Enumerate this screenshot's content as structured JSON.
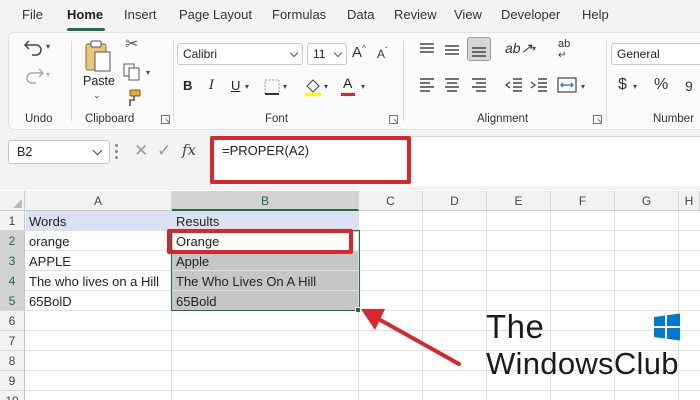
{
  "menu": {
    "items": [
      "File",
      "Home",
      "Insert",
      "Page Layout",
      "Formulas",
      "Data",
      "Review",
      "View",
      "Developer",
      "Help"
    ],
    "active": "Home"
  },
  "ribbon": {
    "groups": {
      "undo": "Undo",
      "clipboard": "Clipboard",
      "font": "Font",
      "alignment": "Alignment",
      "number": "Number"
    },
    "paste_label": "Paste",
    "font_name": "Calibri",
    "font_size": "11",
    "number_format": "General",
    "bold_label": "B",
    "italic_label": "I",
    "underline_label": "U",
    "font_color_label": "A",
    "grow_font_label": "A",
    "shrink_font_label": "A",
    "wrap_label": "ab",
    "currency_label": "$",
    "percent_label": "%",
    "colors": {
      "accent": "#1e7145",
      "underline_red": "#d9262c",
      "highlight_yellow": "#ffff00"
    }
  },
  "formula_bar": {
    "name_box": "B2",
    "cancel": "✕",
    "enter": "✓",
    "fx": "fx",
    "formula": "=PROPER(A2)"
  },
  "sheet": {
    "columns": [
      "A",
      "B",
      "C",
      "D",
      "E",
      "F",
      "G",
      "H"
    ],
    "rows": [
      "1",
      "2",
      "3",
      "4",
      "5",
      "6",
      "7",
      "8",
      "9",
      "10"
    ],
    "cells": {
      "A1": "Words",
      "B1": "Results",
      "A2": "orange",
      "B2": "Orange",
      "A3": "APPLE",
      "B3": "Apple",
      "A4": "The who lives on a Hill",
      "B4": "The Who Lives On A Hill",
      "A5": "65BolD",
      "B5": "65Bold"
    },
    "active_cell": "B2",
    "selected_range": "B2:B5"
  },
  "watermark": {
    "line1": "The",
    "line2": "WindowsClub"
  }
}
